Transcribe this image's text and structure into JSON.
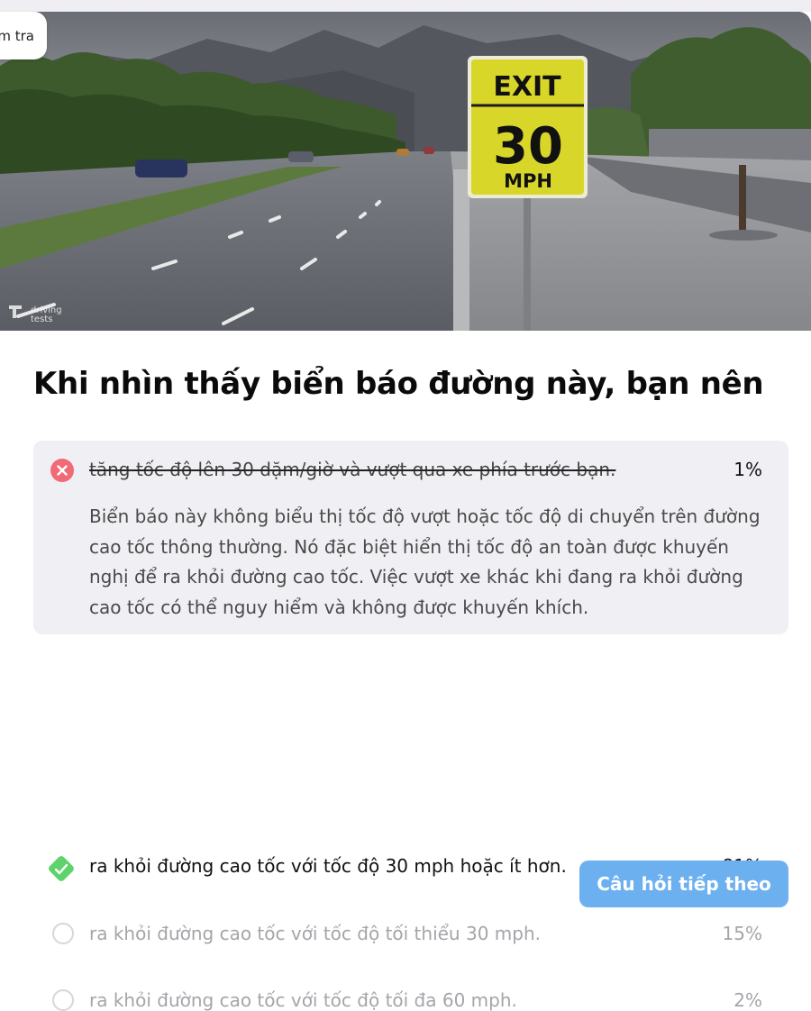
{
  "top_chip": {
    "label": "m tra"
  },
  "hero": {
    "sign_top": "EXIT",
    "sign_number": "30",
    "sign_unit": "MPH",
    "watermark_line1": "driving",
    "watermark_line2": "tests"
  },
  "question": {
    "title": "Khi nhìn thấy biển báo đường này, bạn nên"
  },
  "answers": [
    {
      "text": "tăng tốc độ lên 30 dặm/giờ và vượt qua xe phía trước bạn.",
      "percent": "1%",
      "state": "wrong",
      "explanation": "Biển báo này không biểu thị tốc độ vượt hoặc tốc độ di chuyển trên đường cao tốc thông thường. Nó đặc biệt hiển thị tốc độ an toàn được khuyến nghị để ra khỏi đường cao tốc. Việc vượt xe khác khi đang ra khỏi đường cao tốc có thể nguy hiểm và không được khuyến khích."
    },
    {
      "text": "ra khỏi đường cao tốc với tốc độ 30 mph hoặc ít hơn.",
      "percent": "81%",
      "state": "correct"
    },
    {
      "text": "ra khỏi đường cao tốc với tốc độ tối thiểu 30 mph.",
      "percent": "15%",
      "state": "inactive"
    },
    {
      "text": "ra khỏi đường cao tốc với tốc độ tối đa 60 mph.",
      "percent": "2%",
      "state": "inactive"
    }
  ],
  "next_button": {
    "label": "Câu hỏi tiếp theo"
  },
  "colors": {
    "wrong_icon": "#f16a78",
    "correct_icon": "#5ed36b",
    "button": "#6db0f0",
    "sign_yellow": "#d9d62a"
  }
}
